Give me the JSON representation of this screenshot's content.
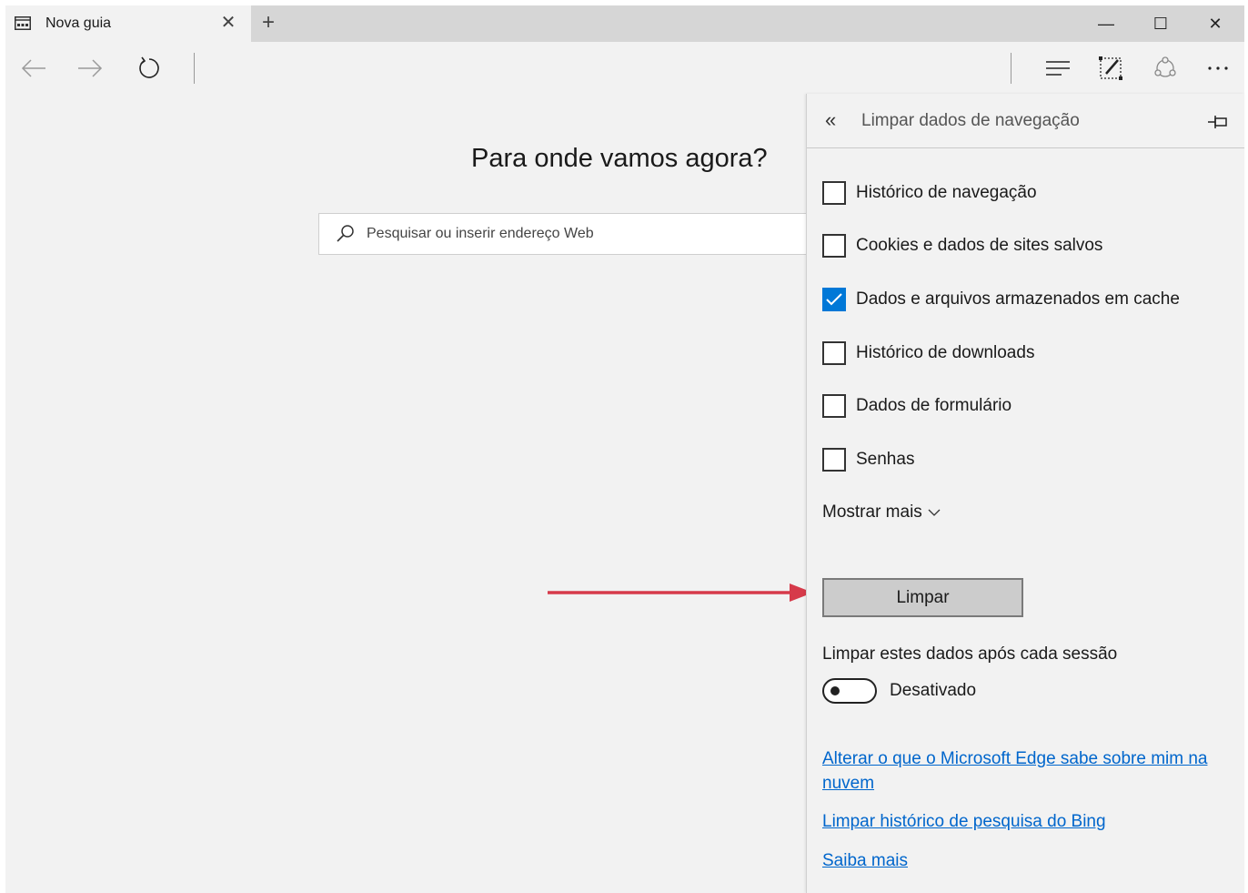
{
  "tab": {
    "title": "Nova guia"
  },
  "window_controls": {
    "minimize": "—",
    "maximize": "☐",
    "close": "✕"
  },
  "main": {
    "headline": "Para onde vamos agora?",
    "search": {
      "placeholder": "Pesquisar ou inserir endereço Web"
    }
  },
  "panel": {
    "title": "Limpar dados de navegação",
    "options": [
      {
        "label": "Histórico de navegação",
        "checked": false
      },
      {
        "label": "Cookies e dados de sites salvos",
        "checked": false
      },
      {
        "label": "Dados e arquivos armazenados em cache",
        "checked": true
      },
      {
        "label": "Histórico de downloads",
        "checked": false
      },
      {
        "label": "Dados de formulário",
        "checked": false
      },
      {
        "label": "Senhas",
        "checked": false
      }
    ],
    "show_more": "Mostrar mais",
    "clear_button": "Limpar",
    "session_label": "Limpar estes dados após cada sessão",
    "toggle": {
      "state_label": "Desativado",
      "on": false
    },
    "links": [
      "Alterar o que o Microsoft Edge sabe sobre mim na nuvem",
      "Limpar histórico de pesquisa do Bing",
      "Saiba mais"
    ]
  },
  "colors": {
    "accent": "#0078d7",
    "link": "#0066cc",
    "arrow": "#d63a4a"
  }
}
